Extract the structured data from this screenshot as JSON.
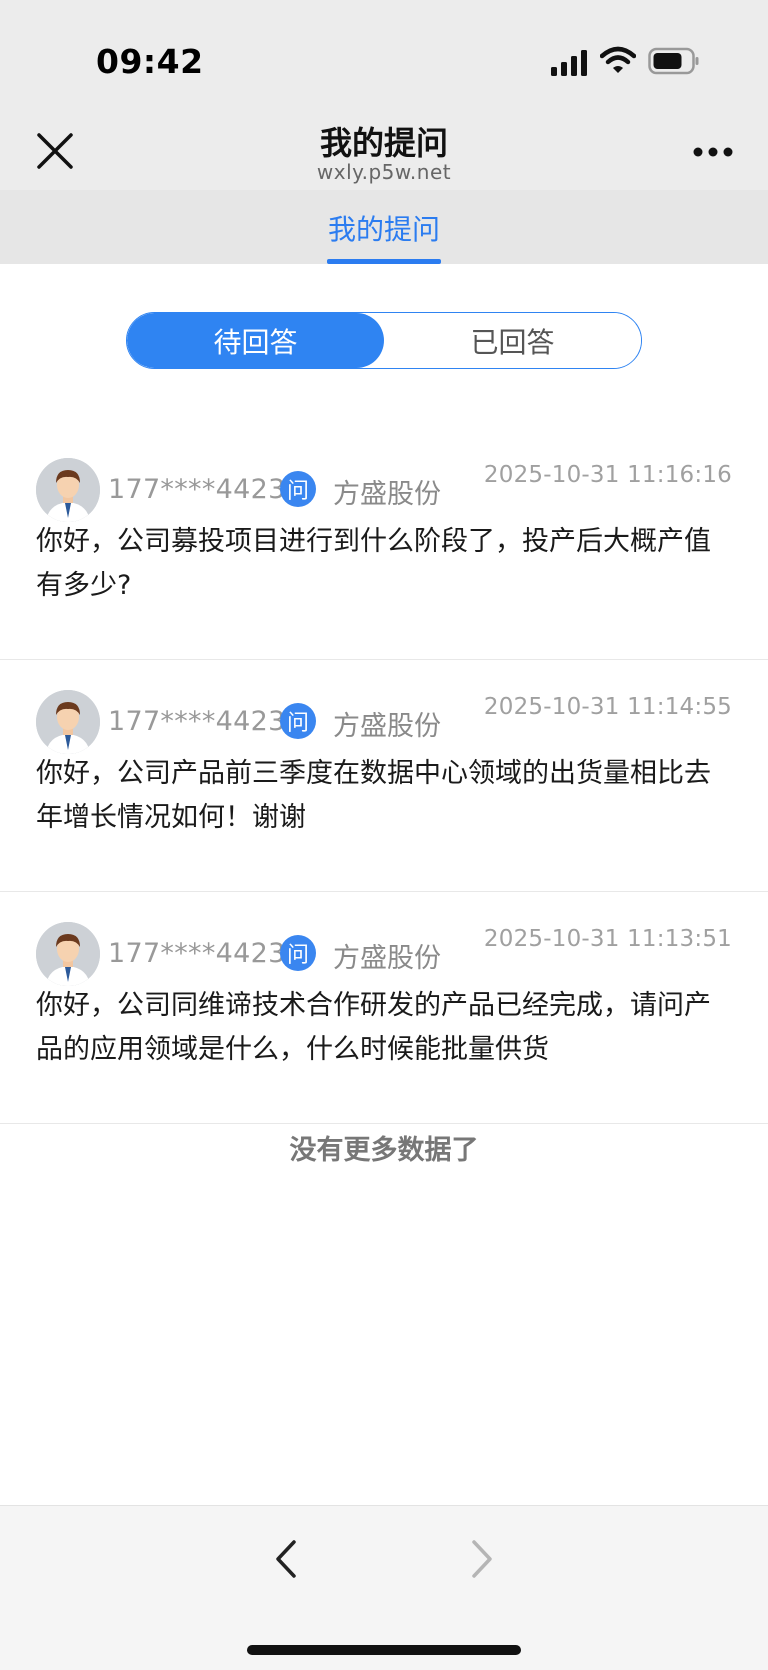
{
  "status_bar": {
    "time": "09:42"
  },
  "nav": {
    "title": "我的提问",
    "subtitle": "wxly.p5w.net"
  },
  "tabs": [
    {
      "label": "我的提问",
      "selected": true
    }
  ],
  "segment": {
    "options": [
      "待回答",
      "已回答"
    ],
    "selected": "待回答"
  },
  "questions": [
    {
      "user": "177****4423",
      "badge": "问",
      "company": "方盛股份",
      "time": "2025-10-31 11:16:16",
      "text": "你好，公司募投项目进行到什么阶段了，投产后大概产值有多少?"
    },
    {
      "user": "177****4423",
      "badge": "问",
      "company": "方盛股份",
      "time": "2025-10-31 11:14:55",
      "text": "你好，公司产品前三季度在数据中心领域的出货量相比去年增长情况如何！谢谢"
    },
    {
      "user": "177****4423",
      "badge": "问",
      "company": "方盛股份",
      "time": "2025-10-31 11:13:51",
      "text": "你好，公司同维谛技术合作研发的产品已经完成，请问产品的应用领域是什么，什么时候能批量供货"
    }
  ],
  "no_more_text": "没有更多数据了",
  "colors": {
    "accent": "#2f84f2",
    "badge": "#3a86f0"
  },
  "icons": [
    "close-icon",
    "more-icon",
    "avatar",
    "back-icon",
    "forward-icon",
    "signal-icon",
    "wifi-icon",
    "battery-icon"
  ]
}
